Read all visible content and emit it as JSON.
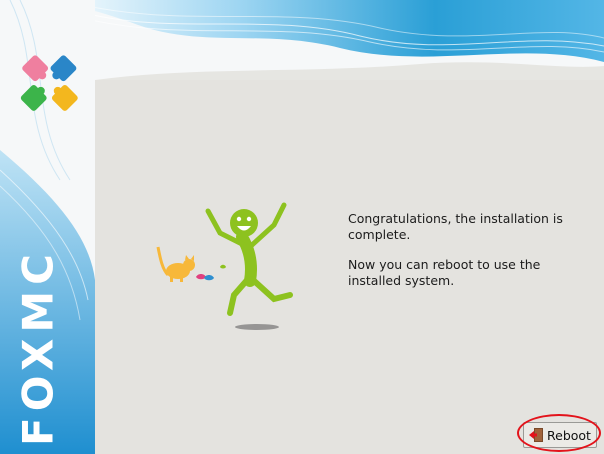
{
  "brand": {
    "name": "foxmc"
  },
  "message": {
    "line1": "Congratulations, the installation is complete.",
    "line2": "Now you can reboot to use the installed system."
  },
  "actions": {
    "reboot_label": "Reboot"
  },
  "colors": {
    "banner_blue": "#2a9fd6",
    "panel_gray": "#e4e3df",
    "mascot_green": "#8dc21f",
    "cat_orange": "#f7b83a",
    "highlight_red": "#e3131b"
  },
  "icons": {
    "logo": "puzzle-icon",
    "reboot": "exit-door-icon"
  }
}
